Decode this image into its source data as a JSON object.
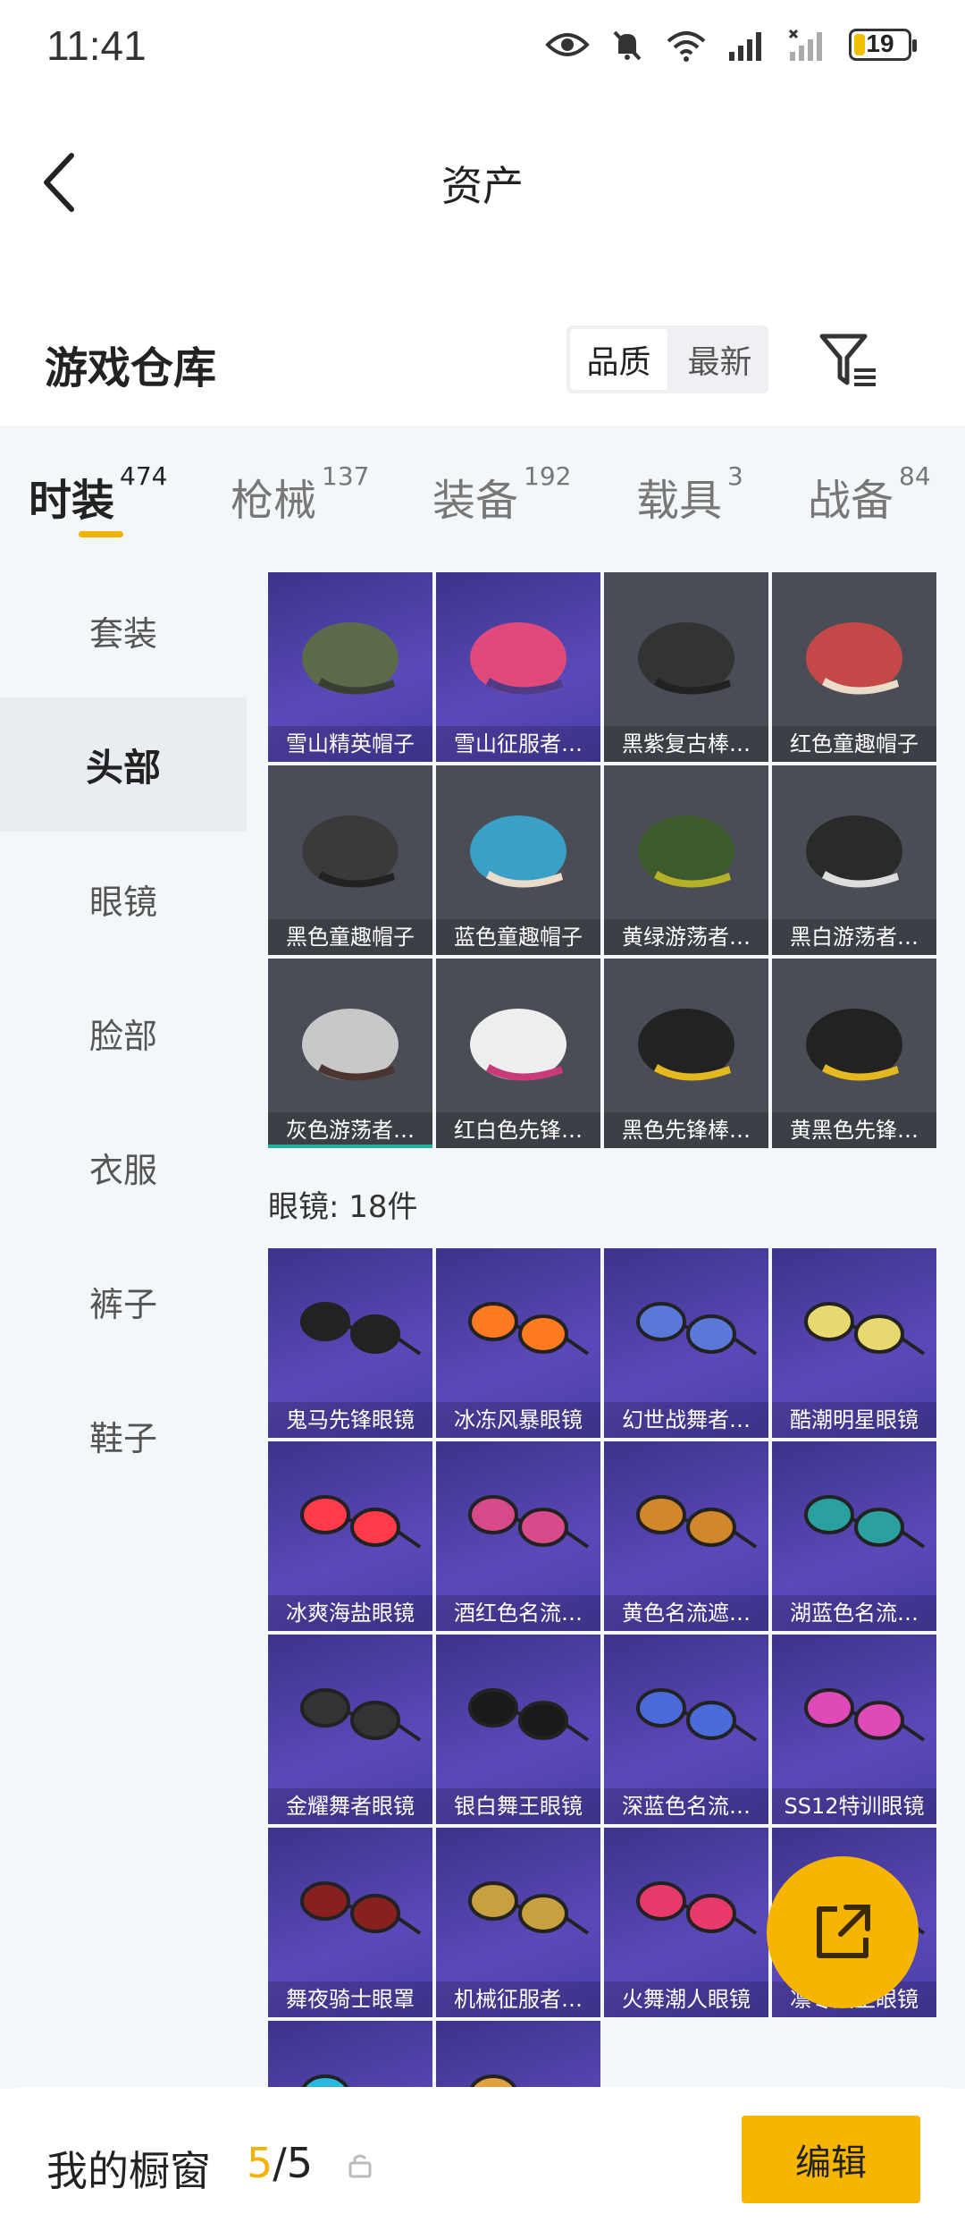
{
  "status_bar": {
    "time": "11:41",
    "battery": "19"
  },
  "header": {
    "title": "资产"
  },
  "warehouse": {
    "title": "游戏仓库",
    "sort_options": [
      "品质",
      "最新"
    ]
  },
  "tabs": [
    {
      "label": "时装",
      "count": "474"
    },
    {
      "label": "枪械",
      "count": "137"
    },
    {
      "label": "装备",
      "count": "192"
    },
    {
      "label": "载具",
      "count": "3"
    },
    {
      "label": "战备",
      "count": "84"
    }
  ],
  "sidebar": [
    "套装",
    "头部",
    "眼镜",
    "脸部",
    "衣服",
    "裤子",
    "鞋子"
  ],
  "head_items": [
    "雪山精英帽子",
    "雪山征服者…",
    "黑紫复古棒…",
    "红色童趣帽子",
    "黑色童趣帽子",
    "蓝色童趣帽子",
    "黄绿游荡者…",
    "黑白游荡者…",
    "灰色游荡者…",
    "红白色先锋…",
    "黑色先锋棒…",
    "黄黑色先锋…"
  ],
  "glasses_section": "眼镜: 18件",
  "glasses_items": [
    "鬼马先锋眼镜",
    "冰冻风暴眼镜",
    "幻世战舞者…",
    "酷潮明星眼镜",
    "冰爽海盐眼镜",
    "酒红色名流…",
    "黄色名流遮…",
    "湖蓝色名流…",
    "金耀舞者眼镜",
    "银白舞王眼镜",
    "深蓝色名流…",
    "SS12特训眼镜",
    "舞夜骑士眼罩",
    "机械征服者…",
    "火舞潮人眼镜",
    "凛冬风王眼镜"
  ],
  "bottom": {
    "label": "我的橱窗",
    "current": "5",
    "total": "/5",
    "edit": "编辑"
  },
  "colors": {
    "accent": "#f7b500",
    "tile_purple": "#4a3ea6",
    "tile_grey": "#4a4d55"
  }
}
